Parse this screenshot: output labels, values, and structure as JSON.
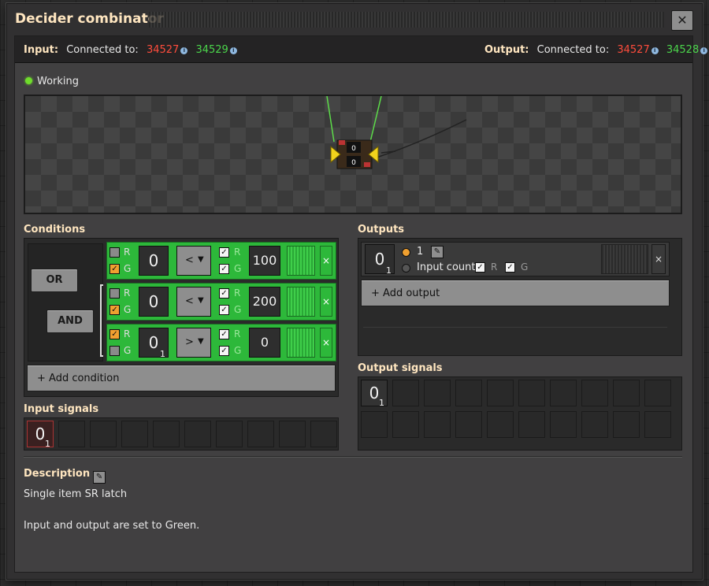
{
  "window": {
    "title": "Decider combinator",
    "close_glyph": "✕"
  },
  "connections": {
    "input_label": "Input:",
    "output_label": "Output:",
    "connected_to": "Connected to:",
    "input_red": "34527",
    "input_green": "34529",
    "output_red": "34527",
    "output_green": "34528",
    "info_glyph": "i"
  },
  "status": {
    "text": "Working",
    "color": "#6fdc2c"
  },
  "conditions": {
    "title": "Conditions",
    "or_label": "OR",
    "and_label": "AND",
    "add_label": "+ Add condition",
    "rows": [
      {
        "left_r": false,
        "left_g": true,
        "signal": "0",
        "signal_sub": "",
        "op": "<",
        "right_r": true,
        "right_g": true,
        "value": "100"
      },
      {
        "left_r": false,
        "left_g": true,
        "signal": "0",
        "signal_sub": "",
        "op": "<",
        "right_r": true,
        "right_g": true,
        "value": "200"
      },
      {
        "left_r": true,
        "left_g": false,
        "signal": "0",
        "signal_sub": "1",
        "op": ">",
        "right_r": true,
        "right_g": true,
        "value": "0"
      }
    ],
    "r_label": "R",
    "g_label": "G",
    "chevron": "▼",
    "delete_glyph": "×"
  },
  "outputs": {
    "title": "Outputs",
    "signal": "0",
    "signal_sub": "1",
    "constant_value": "1",
    "input_count_label": "Input count",
    "r_label": "R",
    "g_label": "G",
    "add_label": "+ Add output",
    "delete_glyph": "×"
  },
  "input_signals": {
    "title": "Input signals",
    "signal": "0",
    "signal_sub": "1"
  },
  "output_signals": {
    "title": "Output signals",
    "signal": "0",
    "signal_sub": "1"
  },
  "description": {
    "title": "Description",
    "line1": "Single item SR latch",
    "line2": "Input and output are set to Green."
  },
  "colors": {
    "accent_title": "#ffe6c0",
    "condition_green": "#2db83a",
    "red_wire": "#ff4c3c",
    "green_wire": "#4bd54b"
  }
}
